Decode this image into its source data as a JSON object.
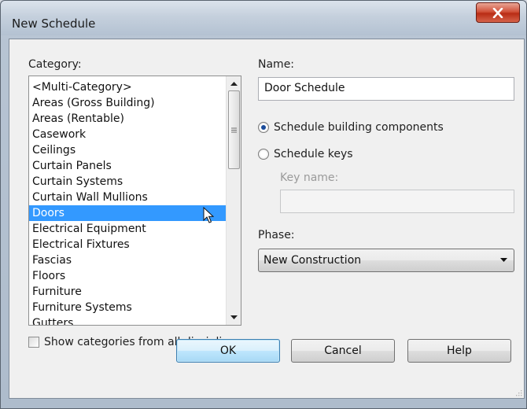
{
  "window": {
    "title": "New Schedule"
  },
  "category": {
    "label": "Category:",
    "items": [
      "<Multi-Category>",
      "Areas (Gross Building)",
      "Areas (Rentable)",
      "Casework",
      "Ceilings",
      "Curtain Panels",
      "Curtain Systems",
      "Curtain Wall Mullions",
      "Doors",
      "Electrical Equipment",
      "Electrical Fixtures",
      "Fascias",
      "Floors",
      "Furniture",
      "Furniture Systems",
      "Gutters"
    ],
    "selected_index": 8,
    "selected_item": "Doors"
  },
  "show_all_disciplines": {
    "label": "Show categories from all disciplines",
    "checked": false
  },
  "name": {
    "label": "Name:",
    "value": "Door Schedule"
  },
  "schedule_type": {
    "options": [
      {
        "label": "Schedule building components",
        "checked": true
      },
      {
        "label": "Schedule keys",
        "checked": false
      }
    ]
  },
  "key_name": {
    "label": "Key name:",
    "value": "",
    "enabled": false
  },
  "phase": {
    "label": "Phase:",
    "value": "New Construction"
  },
  "buttons": {
    "ok": "OK",
    "cancel": "Cancel",
    "help": "Help"
  },
  "colors": {
    "selection": "#3399ff",
    "close_button": "#c7432a",
    "default_button_border": "#3c7fb1"
  }
}
